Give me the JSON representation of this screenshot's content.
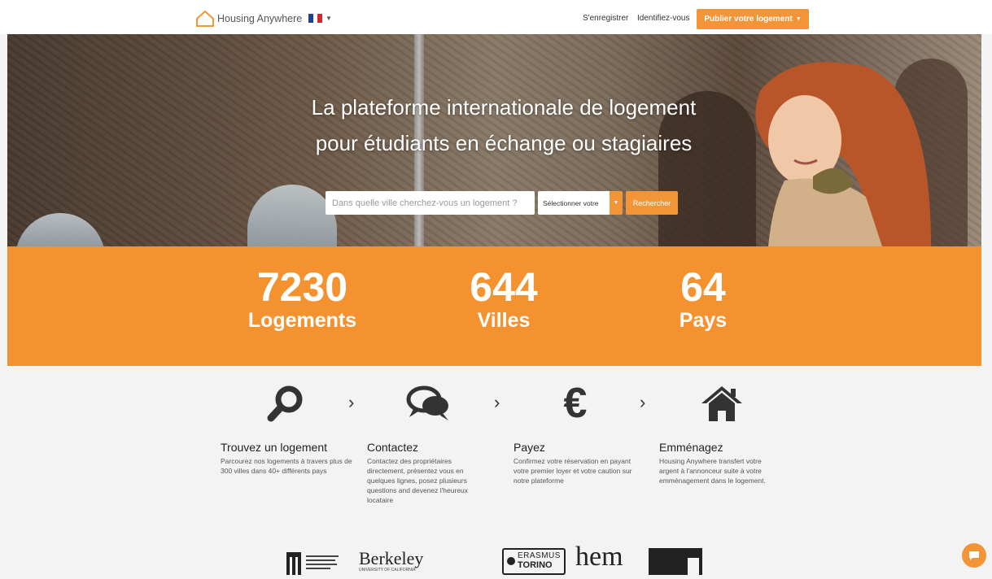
{
  "header": {
    "logo_text": "Housing Anywhere",
    "register_label": "S'enregistrer",
    "login_label": "Identifiez-vous",
    "publish_label": "Publier votre logement"
  },
  "hero": {
    "title_line1": "La plateforme internationale de logement",
    "title_line2": "pour étudiants en échange ou stagiaires",
    "search_placeholder": "Dans quelle ville cherchez-vous un logement ?",
    "select_value": "Sélectionner votre",
    "search_button": "Rechercher"
  },
  "stats": [
    {
      "value": "7230",
      "label": "Logements"
    },
    {
      "value": "644",
      "label": "Villes"
    },
    {
      "value": "64",
      "label": "Pays"
    }
  ],
  "steps": [
    {
      "icon": "search-icon",
      "title": "Trouvez un logement",
      "desc": "Parcourez nos logements à travers plus de 300 villes dans 40+ différents pays"
    },
    {
      "icon": "chat-bubbles-icon",
      "title": "Contactez",
      "desc": "Contactez des propriétaires directement, présentez vous en quelques lignes, posez plusieurs questions and devenez l'heureux locataire"
    },
    {
      "icon": "euro-icon",
      "title": "Payez",
      "desc": "Confirmez votre réservation en payant votre premier loyer et votre caution sur notre plateforme"
    },
    {
      "icon": "home-icon",
      "title": "Emménagez",
      "desc": "Housing Anywhere transfert votre argent à l'annonceur suite à votre emménagement dans le logement."
    }
  ],
  "partners": {
    "berkeley": "Berkeley",
    "berkeley_sub": "UNIVERSITY OF CALIFORNIA",
    "erasmus_line1": "ERASMUS",
    "erasmus_line2": "TORINO",
    "hem": "hem"
  },
  "colors": {
    "accent": "#f39436",
    "stats_bg": "#f3922f"
  }
}
